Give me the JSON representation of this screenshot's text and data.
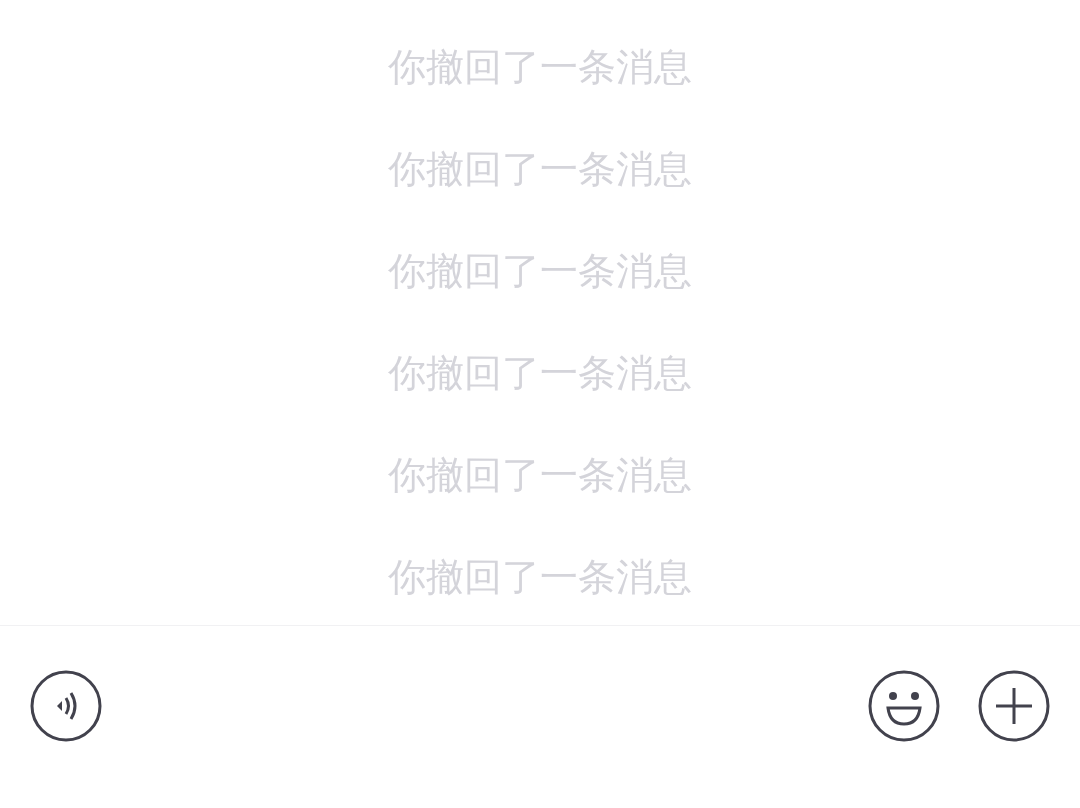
{
  "messages": [
    {
      "kind": "recall",
      "text": "你撤回了一条消息"
    },
    {
      "kind": "recall",
      "text": "你撤回了一条消息"
    },
    {
      "kind": "recall",
      "text": "你撤回了一条消息"
    },
    {
      "kind": "recall",
      "text": "你撤回了一条消息"
    },
    {
      "kind": "recall",
      "text": "你撤回了一条消息"
    },
    {
      "kind": "recall",
      "text": "你撤回了一条消息"
    }
  ]
}
